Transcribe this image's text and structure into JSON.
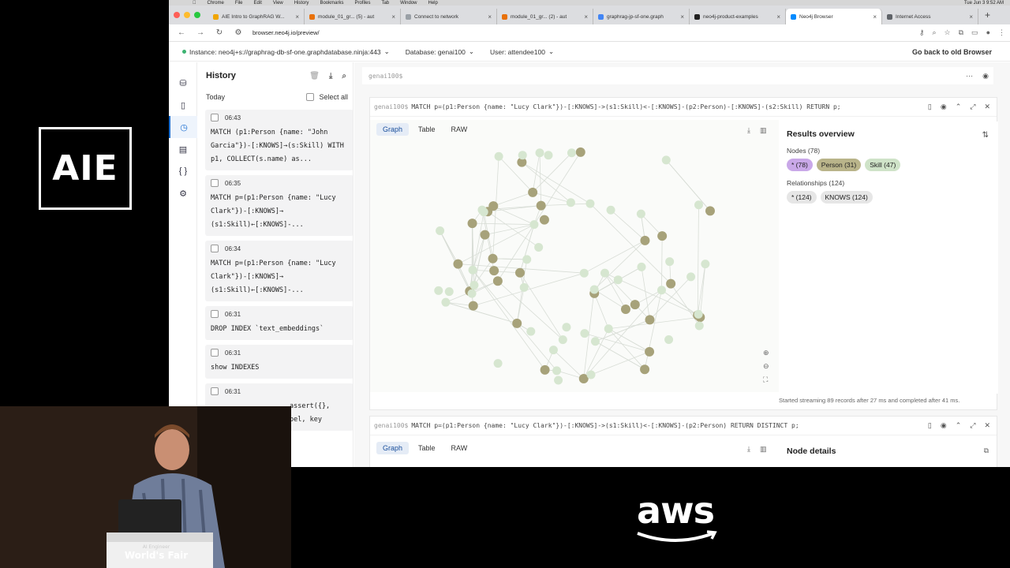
{
  "branding": {
    "aie": "AIE",
    "aws": "aws",
    "podium": "World's Fair",
    "podium_sub": "AI Engineer"
  },
  "menubar": {
    "items": [
      "Chrome",
      "File",
      "Edit",
      "View",
      "History",
      "Bookmarks",
      "Profiles",
      "Tab",
      "Window",
      "Help"
    ],
    "clock": "Tue Jun 3  9:52 AM"
  },
  "tabs": [
    {
      "label": "AIE Intro to GraphRAG W...",
      "active": false
    },
    {
      "label": "module_01_gr... (5) - aut",
      "active": false
    },
    {
      "label": "Connect to network",
      "active": false
    },
    {
      "label": "module_01_gr... (2) - aut",
      "active": false
    },
    {
      "label": "graphrag-jp-sf-one.graph",
      "active": false
    },
    {
      "label": "neo4j-product-examples",
      "active": false
    },
    {
      "label": "Neo4j Browser",
      "active": true
    },
    {
      "label": "Internet Access",
      "active": false
    }
  ],
  "url": "browser.neo4j.io/preview/",
  "header": {
    "instance": "Instance: neo4j+s://graphrag-db-sf-one.graphdatabase.ninja:443",
    "database": "Database: genai100",
    "user": "User: attendee100",
    "back": "Go back to old Browser"
  },
  "history": {
    "title": "History",
    "today": "Today",
    "select_all": "Select all",
    "items": [
      {
        "time": "06:43",
        "query": "MATCH (p1:Person {name: \"John Garcia\"})-[:KNOWS]→(s:Skill) WITH p1, COLLECT(s.name) as..."
      },
      {
        "time": "06:35",
        "query": "MATCH p=(p1:Person {name: \"Lucy Clark\"})-[:KNOWS]→ (s1:Skill)←[:KNOWS]-..."
      },
      {
        "time": "06:34",
        "query": "MATCH p=(p1:Person {name: \"Lucy Clark\"})-[:KNOWS]→ (s1:Skill)←[:KNOWS]-..."
      },
      {
        "time": "06:31",
        "query": "DROP INDEX `text_embeddings`"
      },
      {
        "time": "06:31",
        "query": "show INDEXES"
      },
      {
        "time": "06:31",
        "query": "assert({}, bel, key"
      }
    ]
  },
  "editor": {
    "placeholder": "genai100$"
  },
  "frame1": {
    "prompt": "genai100$",
    "query": "MATCH p=(p1:Person {name: \"Lucy Clark\"})-[:KNOWS]->(s1:Skill)<-[:KNOWS]-(p2:Person)-[:KNOWS]-(s2:Skill) RETURN p;",
    "tabs": [
      "Graph",
      "Table",
      "RAW"
    ],
    "results_title": "Results overview",
    "nodes_label": "Nodes (78)",
    "node_chips": [
      {
        "label": "* (78)",
        "color": "#c9a8e8"
      },
      {
        "label": "Person (31)",
        "color": "#b9b48a"
      },
      {
        "label": "Skill (47)",
        "color": "#cfe3c8"
      }
    ],
    "rels_label": "Relationships (124)",
    "rel_chips": [
      {
        "label": "* (124)",
        "color": "#e6e6e6"
      },
      {
        "label": "KNOWS (124)",
        "color": "#e6e6e6"
      }
    ],
    "status": "Started streaming 89 records after 27 ms and completed after 41 ms."
  },
  "frame2": {
    "prompt": "genai100$",
    "query": "MATCH p=(p1:Person {name: \"Lucy Clark\"})-[:KNOWS]->(s1:Skill)<-[:KNOWS]-(p2:Person) RETURN DISTINCT p;",
    "tabs": [
      "Graph",
      "Table",
      "RAW"
    ],
    "details_title": "Node details"
  },
  "colors": {
    "person": "#a7a27a",
    "skill": "#d6e6d0",
    "accent": "#1a6ed1"
  }
}
